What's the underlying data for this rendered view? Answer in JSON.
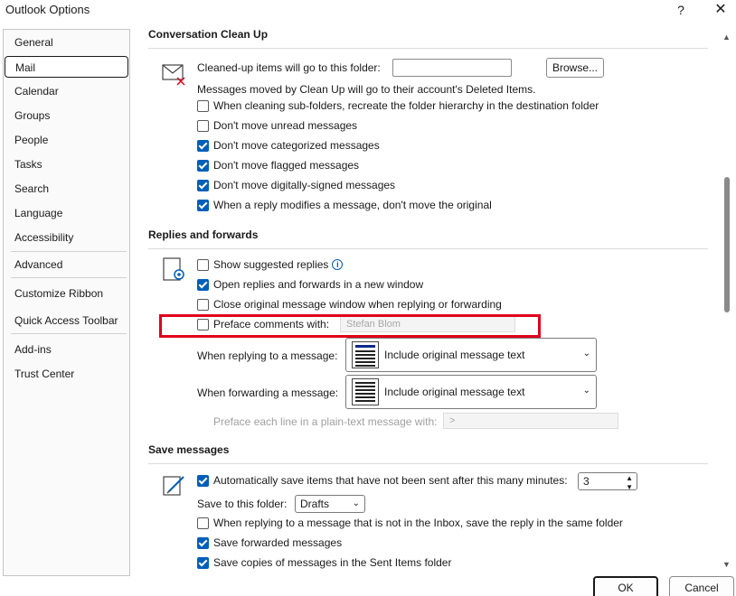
{
  "window": {
    "title": "Outlook Options",
    "help": "?",
    "close": "✕"
  },
  "sidebar": {
    "items": [
      {
        "label": "General"
      },
      {
        "label": "Mail"
      },
      {
        "label": "Calendar"
      },
      {
        "label": "Groups"
      },
      {
        "label": "People"
      },
      {
        "label": "Tasks"
      },
      {
        "label": "Search"
      },
      {
        "label": "Language"
      },
      {
        "label": "Accessibility"
      },
      {
        "label": "Advanced"
      },
      {
        "label": "Customize Ribbon"
      },
      {
        "label": "Quick Access Toolbar"
      },
      {
        "label": "Add-ins"
      },
      {
        "label": "Trust Center"
      }
    ],
    "selected": "Mail"
  },
  "cleanup": {
    "title": "Conversation Clean Up",
    "folder_label": "Cleaned-up items will go to this folder:",
    "folder_value": "",
    "browse": "Browse...",
    "note": "Messages moved by Clean Up will go to their account's Deleted Items.",
    "options": [
      {
        "label": "When cleaning sub-folders, recreate the folder hierarchy in the destination folder",
        "checked": false
      },
      {
        "label": "Don't move unread messages",
        "checked": false
      },
      {
        "label": "Don't move categorized messages",
        "checked": true
      },
      {
        "label": "Don't move flagged messages",
        "checked": true
      },
      {
        "label": "Don't move digitally-signed messages",
        "checked": true
      },
      {
        "label": "When a reply modifies a message, don't move the original",
        "checked": true
      }
    ]
  },
  "replies": {
    "title": "Replies and forwards",
    "options": [
      {
        "label": "Show suggested replies",
        "checked": false
      },
      {
        "label": "Open replies and forwards in a new window",
        "checked": true
      },
      {
        "label": "Close original message window when replying or forwarding",
        "checked": false
      },
      {
        "label": "Preface comments with:",
        "checked": false
      }
    ],
    "preface_value": "Stefan Blom",
    "replying_label": "When replying to a message:",
    "replying_value": "Include original message text",
    "forwarding_label": "When forwarding a message:",
    "forwarding_value": "Include original message text",
    "plaintext_label": "Preface each line in a plain-text message with:",
    "plaintext_value": ">"
  },
  "save": {
    "title": "Save messages",
    "autosave_label": "Automatically save items that have not been sent after this many minutes:",
    "autosave_checked": true,
    "autosave_minutes": "3",
    "folder_label": "Save to this folder:",
    "folder_value": "Drafts",
    "options": [
      {
        "label": "When replying to a message that is not in the Inbox, save the reply in the same folder",
        "checked": false
      },
      {
        "label": "Save forwarded messages",
        "checked": true
      },
      {
        "label": "Save copies of messages in the Sent Items folder",
        "checked": true
      }
    ]
  },
  "footer": {
    "ok": "OK",
    "cancel": "Cancel"
  },
  "colors": {
    "accent": "#005fb8",
    "highlight": "#e0001b"
  }
}
